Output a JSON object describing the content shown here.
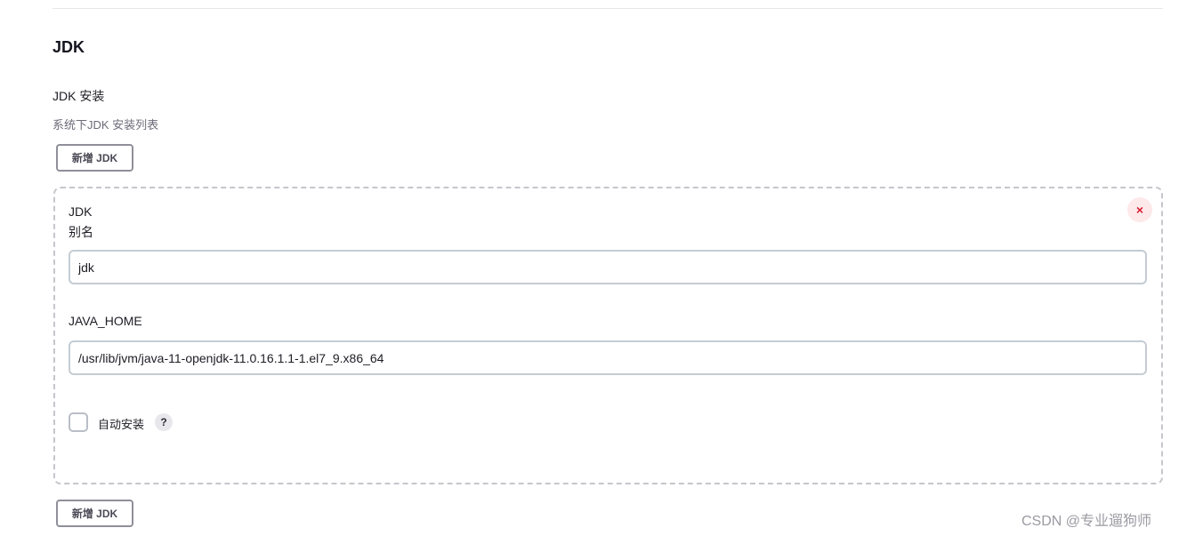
{
  "section": {
    "title": "JDK",
    "field_label": "JDK 安装",
    "field_description": "系统下JDK 安装列表",
    "add_button_label": "新增 JDK"
  },
  "jdk_item": {
    "heading": "JDK",
    "close_symbol": "×",
    "alias_label": "别名",
    "alias_value": "jdk",
    "java_home_label": "JAVA_HOME",
    "java_home_value": "/usr/lib/jvm/java-11-openjdk-11.0.16.1.1-1.el7_9.x86_64",
    "auto_install_label": "自动安装",
    "auto_install_checked": false,
    "help_symbol": "?"
  },
  "watermark": "CSDN @专业遛狗师",
  "colors": {
    "close_icon": "#d81b2f",
    "close_bg": "#fde8ea",
    "button_border": "#8f8f9a",
    "input_border": "#c5ccd3",
    "description_text": "#6d6b78"
  },
  "icons": {
    "close": "close-icon",
    "help": "help-icon"
  }
}
